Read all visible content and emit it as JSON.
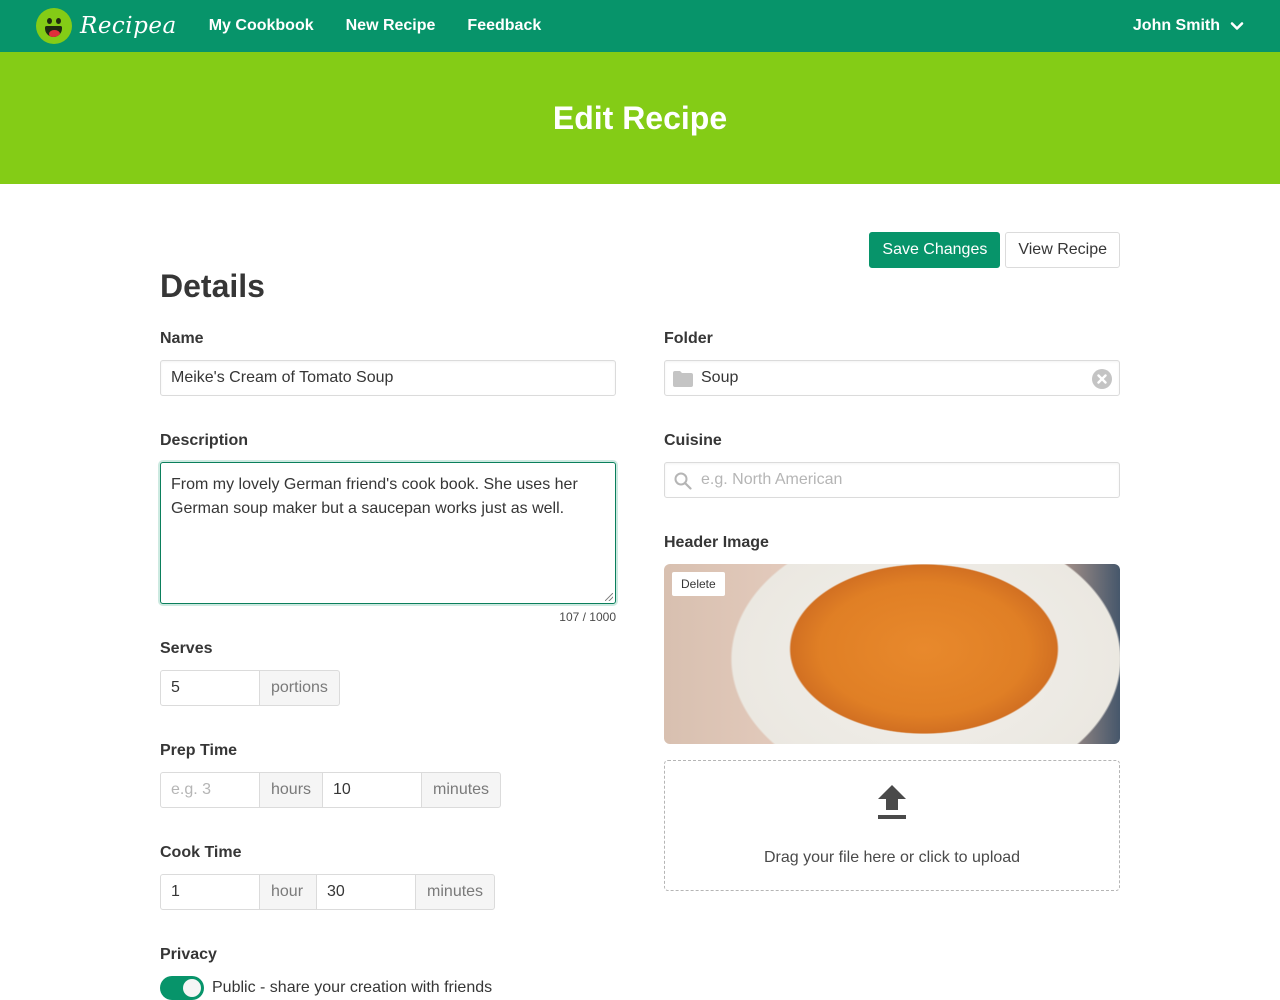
{
  "navbar": {
    "brand": "Recipea",
    "links": [
      "My Cookbook",
      "New Recipe",
      "Feedback"
    ],
    "user": "John Smith"
  },
  "hero": {
    "title": "Edit Recipe"
  },
  "toolbar": {
    "save_label": "Save Changes",
    "view_label": "View Recipe"
  },
  "section": {
    "title": "Details"
  },
  "form": {
    "name": {
      "label": "Name",
      "value": "Meike's Cream of Tomato Soup"
    },
    "description": {
      "label": "Description",
      "value": "From my lovely German friend's cook book. She uses her German soup maker but a saucepan works just as well.",
      "counter": "107 / 1000"
    },
    "serves": {
      "label": "Serves",
      "value": "5",
      "unit": "portions"
    },
    "prep_time": {
      "label": "Prep Time",
      "hours_placeholder": "e.g. 3",
      "hours_unit": "hours",
      "minutes_value": "10",
      "minutes_unit": "minutes"
    },
    "cook_time": {
      "label": "Cook Time",
      "hours_value": "1",
      "hours_unit": "hour",
      "minutes_value": "30",
      "minutes_unit": "minutes"
    },
    "privacy": {
      "label": "Privacy",
      "toggle_label": "Public - share your creation with friends",
      "enabled": true
    },
    "folder": {
      "label": "Folder",
      "value": "Soup",
      "icon": "folder-icon",
      "clear_icon": "clear-icon"
    },
    "cuisine": {
      "label": "Cuisine",
      "placeholder": "e.g. North American",
      "icon": "search-icon"
    },
    "header_image": {
      "label": "Header Image",
      "delete_label": "Delete"
    },
    "upload": {
      "text": "Drag your file here or click to upload",
      "icon": "upload-icon"
    }
  },
  "colors": {
    "primary": "#07946a",
    "accent": "#84cc16"
  }
}
